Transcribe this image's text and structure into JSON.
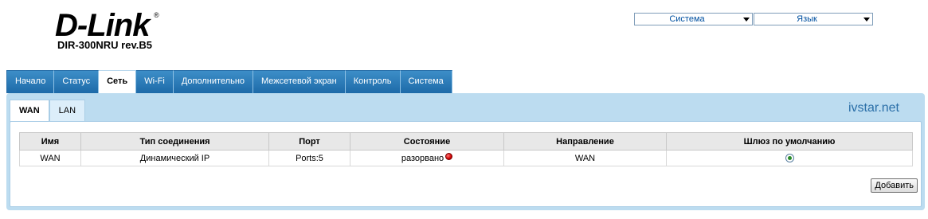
{
  "logo": {
    "brand": "D-Link",
    "reg": "®",
    "model": "DIR-300NRU rev.B5"
  },
  "top": {
    "system_select": "Система",
    "language_select": "Язык"
  },
  "nav": {
    "tabs": [
      "Начало",
      "Статус",
      "Сеть",
      "Wi-Fi",
      "Дополнительно",
      "Межсетевой экран",
      "Контроль",
      "Система"
    ],
    "active": "Сеть"
  },
  "subnav": {
    "tabs": [
      "WAN",
      "LAN"
    ],
    "active": "WAN"
  },
  "watermark": "ivstar.net",
  "table": {
    "headers": [
      "Имя",
      "Тип соединения",
      "Порт",
      "Состояние",
      "Направление",
      "Шлюз по умолчанию"
    ],
    "rows": [
      {
        "name": "WAN",
        "type": "Динамический IP",
        "port": "Ports:5",
        "state": "разорвано",
        "direction": "WAN",
        "default_gw": true
      }
    ]
  },
  "buttons": {
    "add": "Добавить"
  },
  "colors": {
    "tab_blue": "#1d6aa8",
    "panel": "#bcdcf0",
    "status_disconnected": "#d00000"
  }
}
